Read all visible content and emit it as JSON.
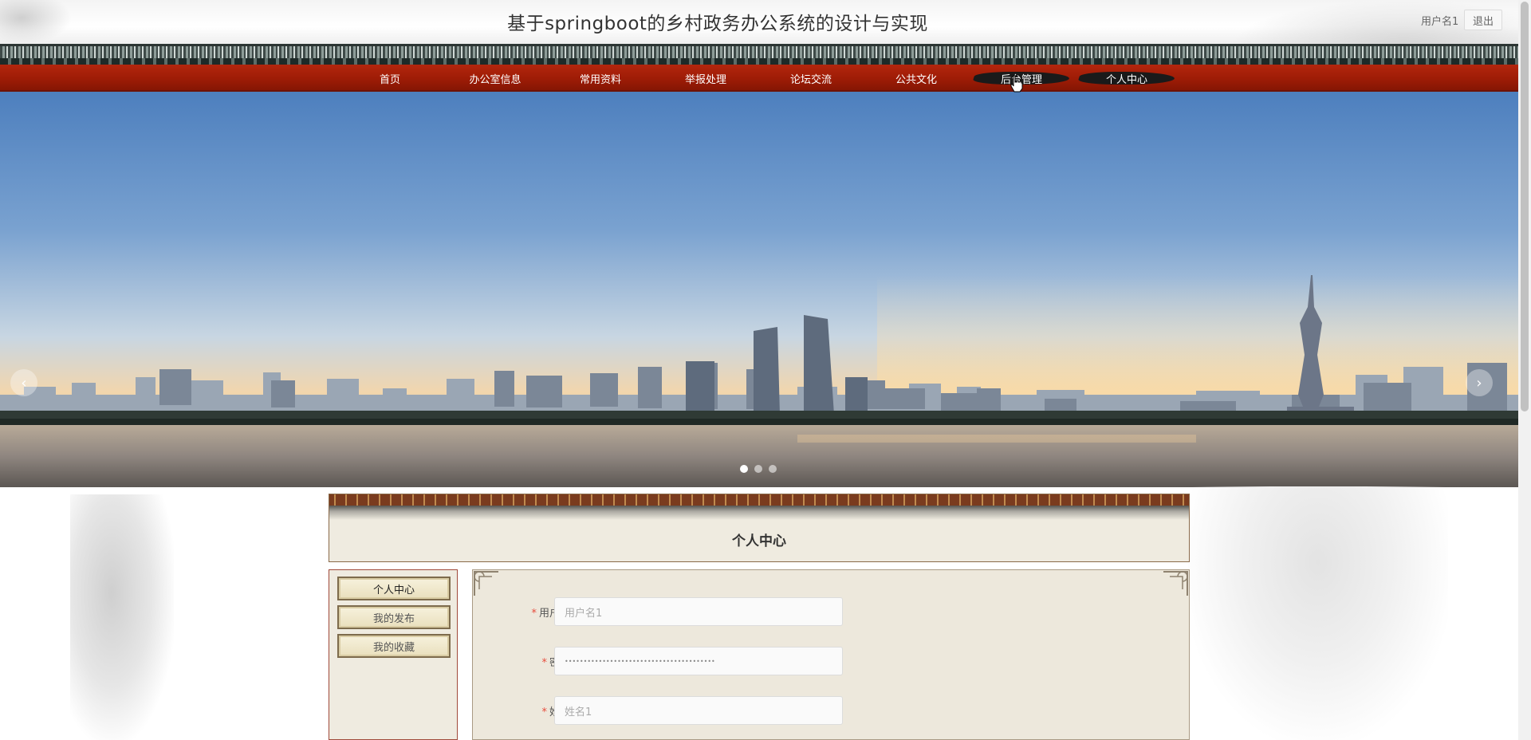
{
  "header": {
    "site_title": "基于springboot的乡村政务办公系统的设计与实现",
    "user_name": "用户名1",
    "logout_label": "退出"
  },
  "nav": {
    "items": [
      {
        "label": "首页"
      },
      {
        "label": "办公室信息"
      },
      {
        "label": "常用资料"
      },
      {
        "label": "举报处理"
      },
      {
        "label": "论坛交流"
      },
      {
        "label": "公共文化"
      },
      {
        "label": "后台管理"
      },
      {
        "label": "个人中心"
      }
    ]
  },
  "banner": {
    "prev_label": "‹",
    "next_label": "›",
    "slide_count": 3,
    "active_slide": 1
  },
  "section": {
    "title": "个人中心"
  },
  "sidebar": {
    "items": [
      {
        "label": "个人中心"
      },
      {
        "label": "我的发布"
      },
      {
        "label": "我的收藏"
      }
    ]
  },
  "form": {
    "fields": [
      {
        "label": "用户名",
        "required_mark": "*",
        "value": "用户名1"
      },
      {
        "label": "密码",
        "required_mark": "*",
        "value": "••••••••••••••••••••••••••••••••••••••••"
      },
      {
        "label": "姓名",
        "required_mark": "*",
        "value": "姓名1"
      }
    ]
  },
  "colors": {
    "nav_red": "#9e1c06",
    "panel_bg": "#ede8dc",
    "required": "#e74c3c"
  }
}
